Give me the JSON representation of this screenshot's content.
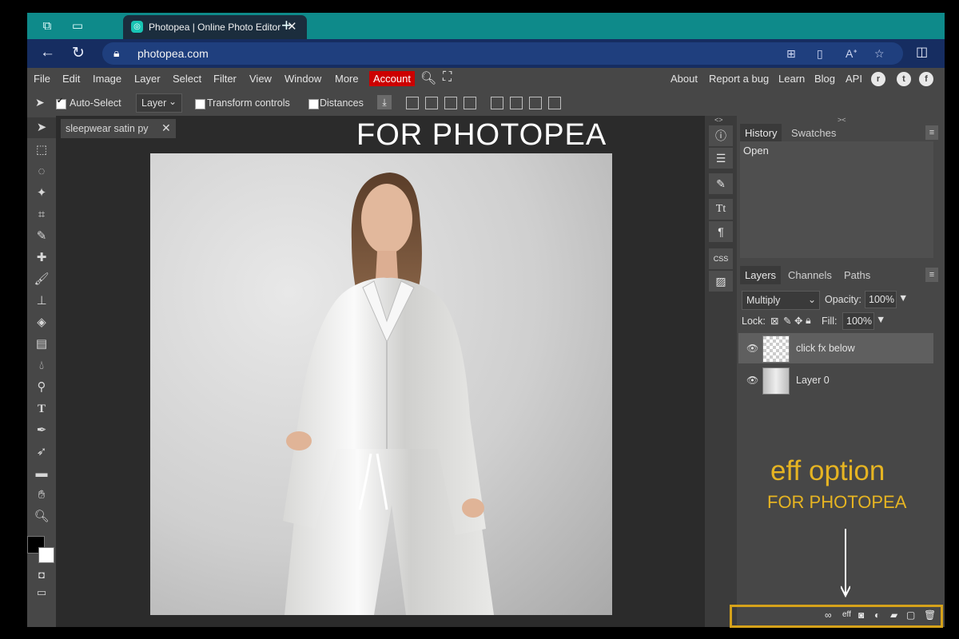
{
  "browser": {
    "tab_title": "Photopea | Online Photo Editor",
    "url": "photopea.com"
  },
  "menubar": {
    "items": [
      "File",
      "Edit",
      "Image",
      "Layer",
      "Select",
      "Filter",
      "View",
      "Window",
      "More"
    ],
    "account": "Account",
    "right_items": [
      "About",
      "Report a bug",
      "Learn",
      "Blog",
      "API"
    ]
  },
  "options": {
    "auto_select_label": "Auto-Select",
    "auto_select_checked": true,
    "layer_select": "Layer",
    "transform_controls": "Transform controls",
    "distances": "Distances"
  },
  "document": {
    "tab_name": "sleepwear satin py",
    "overlay_title": "FOR PHOTOPEA"
  },
  "panels": {
    "history_tab": "History",
    "swatches_tab": "Swatches",
    "history_items": [
      "Open"
    ],
    "layers_tab": "Layers",
    "channels_tab": "Channels",
    "paths_tab": "Paths",
    "blend_mode": "Multiply",
    "opacity_label": "Opacity:",
    "opacity_value": "100%",
    "lock_label": "Lock:",
    "fill_label": "Fill:",
    "fill_value": "100%",
    "layers": [
      {
        "name": "click fx below",
        "selected": true
      },
      {
        "name": "Layer 0",
        "selected": false
      }
    ],
    "bottom_icons": [
      "link-icon",
      "fx-icon",
      "mask-icon",
      "adjustment-icon",
      "folder-icon",
      "new-layer-icon",
      "trash-icon"
    ]
  },
  "annotations": {
    "eff_option": "eff option",
    "for_photopea": "FOR PHOTOPEA",
    "highlight_color": "#d6a21a"
  },
  "colors": {
    "tabbar": "#0e8a8a",
    "addressbar": "#162d61",
    "account": "#cc0000",
    "app_bg": "#474747",
    "canvas_bg": "#2b2b2b"
  }
}
